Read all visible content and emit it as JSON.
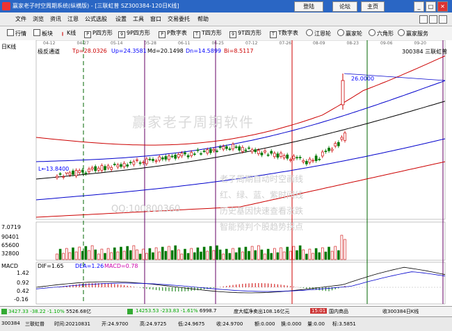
{
  "window": {
    "title": "赢家老子时空周期系统(纵横版) - [三联虹普  SZ300384-120日K线]",
    "btn_login": "登陆",
    "btn_forum": "论坛",
    "btn_home": "主页"
  },
  "menu": [
    "文件",
    "浏览",
    "资讯",
    "江恩",
    "公式选股",
    "设置",
    "工具",
    "窗口",
    "交易委托",
    "帮助"
  ],
  "toolbar": [
    "行情",
    "板块",
    "K线",
    "P四方形",
    "9P四方形",
    "P数字表",
    "T四方形",
    "9T四方形",
    "T数字表",
    "江恩轮",
    "赢家轮",
    "六角形",
    "赢家服务"
  ],
  "chart": {
    "period_label": "日K线",
    "channel_label": "极反通道",
    "tp": "Tp=28.0326",
    "up": "Up=24.3581",
    "md": "Md=20.1498",
    "dn": "Dn=14.5899",
    "bi": "Bi=8.5117",
    "stock_name": "300384 三联虹普",
    "dates": [
      "04-12",
      "04-27",
      "05-14",
      "05-28",
      "06-11",
      "06-25",
      "07-12",
      "07-26",
      "08-09",
      "08-23",
      "09-06",
      "09-20"
    ],
    "price_high_mark": "26.0000",
    "price_low_mark": "13.8400",
    "watermark": "赢家老子周期软件",
    "qq": "QQ:100800360",
    "promo_lines": [
      "老子周期自动时空画线",
      "红、绿、蓝、紫时间线",
      "历史基因快速查看涨跌",
      "智能预判个股趋势拐点"
    ],
    "vol_labels": [
      "7.0719",
      "90401",
      "65600",
      "32800"
    ],
    "macd_label": "MACD",
    "dif": "DIF=1.65",
    "dea": "DEA=1.26",
    "macd": "MACD=0.78",
    "macd_axis": [
      "1.42",
      "0.92",
      "0.42",
      "-0.16"
    ]
  },
  "chart_data": {
    "type": "candlestick",
    "x": [
      "04-12",
      "04-27",
      "05-14",
      "05-28",
      "06-11",
      "06-25",
      "07-12",
      "07-26",
      "08-09",
      "08-23",
      "09-06",
      "09-20"
    ],
    "ylim": [
      13.84,
      26.0
    ],
    "channel": {
      "Tp": 28.0326,
      "Up": 24.3581,
      "Md": 20.1498,
      "Dn": 14.5899,
      "Bi": 8.5117
    },
    "macd": {
      "DIF": 1.65,
      "DEA": 1.26,
      "MACD": 0.78
    }
  },
  "status": {
    "sh": "3427.33",
    "sh_chg": "-38.22",
    "sh_pct": "-1.10%",
    "sh_amt": "5526.68亿",
    "sz": "14253.53",
    "sz_chg": "-233.83",
    "sz_pct": "-1.61%",
    "sz_amt": "6998.7",
    "notice": "度大幅净卖出108.16亿元",
    "time": "15:01",
    "region": "国内商品",
    "market": "收300384日K线"
  },
  "info": {
    "code": "300384",
    "name": "三联虹普",
    "time": "时间:20210831",
    "open": "开:24.9700",
    "high": "高:24.9725",
    "low": "低:24.9675",
    "close": "收:24.9700",
    "vol": "额:0.000",
    "turnover": "换:0.000",
    "amount": "量:0.00",
    "idx": "标:3.5851"
  }
}
